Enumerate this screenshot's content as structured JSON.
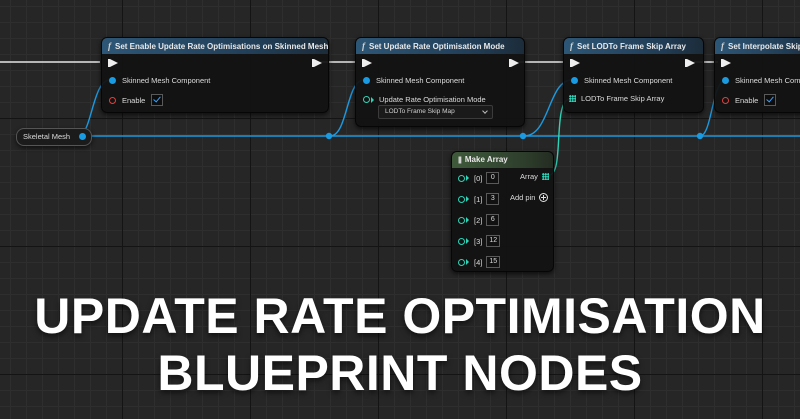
{
  "nodes": {
    "n1": {
      "title": "Set Enable Update Rate Optimisations on Skinned Mesh",
      "pin_target": "Skinned Mesh Component",
      "pin_enable": "Enable"
    },
    "n2": {
      "title": "Set Update Rate Optimisation Mode",
      "pin_target": "Skinned Mesh Component",
      "pin_mode": "Update Rate Optimisation Mode",
      "mode_value": "LODTo Frame Skip Map"
    },
    "n3": {
      "title": "Set LODTo Frame Skip Array",
      "pin_target": "Skinned Mesh Component",
      "pin_array": "LODTo Frame Skip Array"
    },
    "n4": {
      "title": "Set Interpolate Skippe",
      "pin_target": "Skinned Mesh Compo",
      "pin_enable": "Enable"
    },
    "make_array": {
      "title": "Make Array",
      "output": "Array",
      "add_pin": "Add pin",
      "items": [
        {
          "label": "[0]",
          "value": "0"
        },
        {
          "label": "[1]",
          "value": "3"
        },
        {
          "label": "[2]",
          "value": "6"
        },
        {
          "label": "[3]",
          "value": "12"
        },
        {
          "label": "[4]",
          "value": "15"
        }
      ]
    },
    "skeletal_mesh": {
      "label": "Skeletal Mesh"
    }
  },
  "overlay": {
    "line1": "UPDATE RATE OPTIMISATION",
    "line2": "BLUEPRINT NODES"
  },
  "colors": {
    "object_pin": "#1a9ae0",
    "bool_pin": "#e04040",
    "int_pin": "#2ed4b8",
    "exec_pin": "#eeeeee",
    "function_header": "#2d5676",
    "pure_header": "#3f5a3b"
  }
}
